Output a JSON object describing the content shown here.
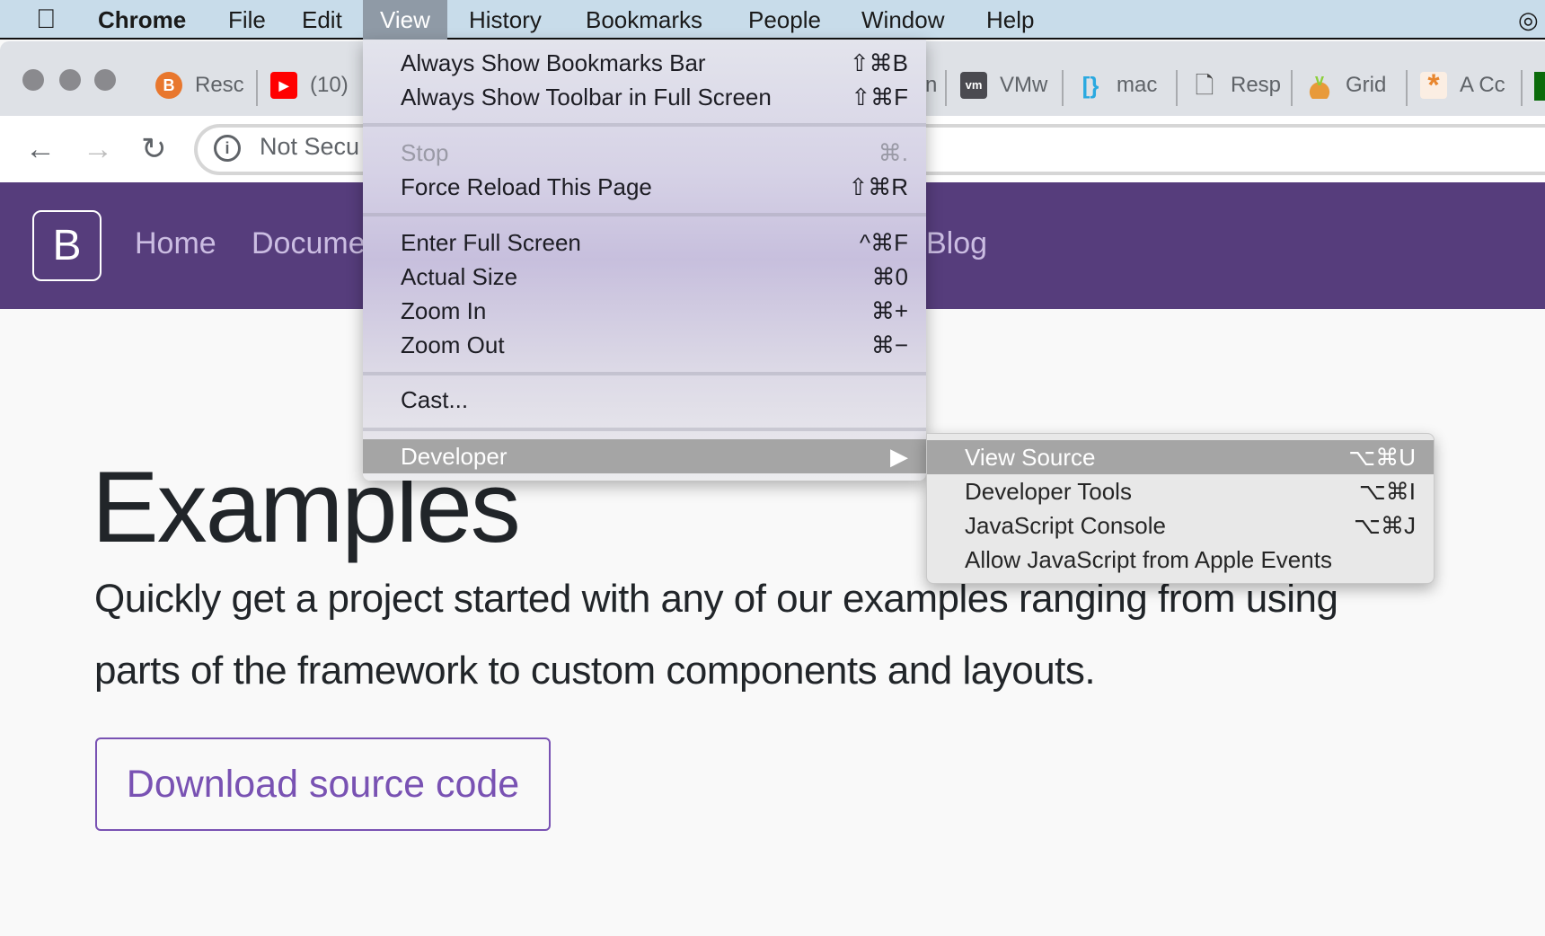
{
  "menubar": {
    "apple": "",
    "app": "Chrome",
    "items": [
      "File",
      "Edit",
      "View",
      "History",
      "Bookmarks",
      "People",
      "Window",
      "Help"
    ],
    "active": "View"
  },
  "tabs": [
    {
      "title": "Resc",
      "icon": "bootstrap-icon",
      "color": "#e8772e"
    },
    {
      "title": "(10)",
      "icon": "youtube-icon",
      "color": "#ff0000"
    },
    {
      "title": "n",
      "icon": ""
    },
    {
      "title": "VMw",
      "icon": "vmware-icon",
      "color": "#4a4a50"
    },
    {
      "title": "mac",
      "icon": "brackets-icon",
      "color": "#2aa9e0"
    },
    {
      "title": "Resp",
      "icon": "document-icon",
      "color": "#444"
    },
    {
      "title": "Grid",
      "icon": "sprout-icon",
      "color": "#e89a3a"
    },
    {
      "title": "A Cc",
      "icon": "asterisk-icon",
      "color": "#e8862e"
    }
  ],
  "toolbar": {
    "address": "Not Secu"
  },
  "site": {
    "logo": "B",
    "nav": [
      "Home",
      "Docume",
      "Blog"
    ],
    "heading": "Examples",
    "para": [
      "Quickly get a project started with any of our examples ranging from using",
      "parts of the framework to custom components and layouts."
    ],
    "button": "Download source code"
  },
  "view_menu": [
    {
      "label": "Always Show Bookmarks Bar",
      "shortcut": "⇧⌘B"
    },
    {
      "label": "Always Show Toolbar in Full Screen",
      "shortcut": "⇧⌘F"
    },
    {
      "label": "Stop",
      "shortcut": "⌘.",
      "disabled": true
    },
    {
      "label": "Force Reload This Page",
      "shortcut": "⇧⌘R"
    },
    {
      "label": "Enter Full Screen",
      "shortcut": "^⌘F"
    },
    {
      "label": "Actual Size",
      "shortcut": "⌘0"
    },
    {
      "label": "Zoom In",
      "shortcut": "⌘+"
    },
    {
      "label": "Zoom Out",
      "shortcut": "⌘−"
    },
    {
      "label": "Cast...",
      "shortcut": ""
    },
    {
      "label": "Developer",
      "shortcut": "▶",
      "highlighted": true
    }
  ],
  "developer_menu": [
    {
      "label": "View Source",
      "shortcut": "⌥⌘U",
      "highlighted": true
    },
    {
      "label": "Developer Tools",
      "shortcut": "⌥⌘I"
    },
    {
      "label": "JavaScript Console",
      "shortcut": "⌥⌘J"
    },
    {
      "label": "Allow JavaScript from Apple Events",
      "shortcut": ""
    }
  ]
}
